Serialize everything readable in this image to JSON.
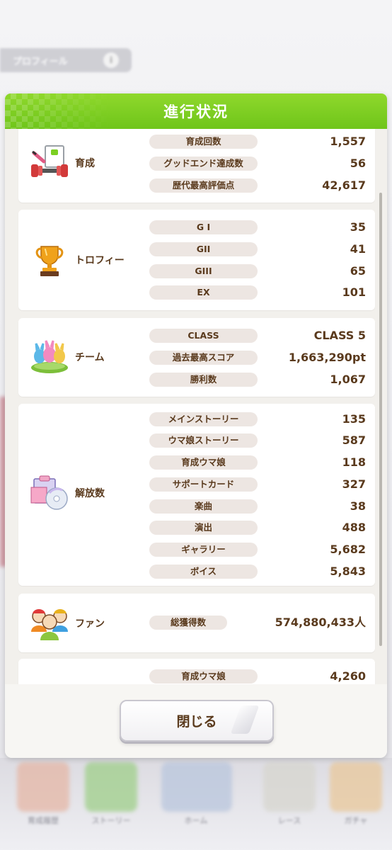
{
  "background": {
    "tab_label": "プロフィール",
    "tab_badge": "i",
    "bottom_labels": [
      "育成履歴",
      "ストーリー",
      "ホーム",
      "レース",
      "ガチャ"
    ]
  },
  "dialog": {
    "title": "進行状況",
    "close_label": "閉じる"
  },
  "sections": [
    {
      "name": "育成",
      "icon": "training-dumbbell-icon",
      "rows": [
        {
          "label": "育成回数",
          "value": "1,557"
        },
        {
          "label": "グッドエンド達成数",
          "value": "56"
        },
        {
          "label": "歴代最高評価点",
          "value": "42,617"
        }
      ]
    },
    {
      "name": "トロフィー",
      "icon": "trophy-icon",
      "rows": [
        {
          "label": "G I",
          "value": "35"
        },
        {
          "label": "GII",
          "value": "41"
        },
        {
          "label": "GIII",
          "value": "65"
        },
        {
          "label": "EX",
          "value": "101"
        }
      ]
    },
    {
      "name": "チーム",
      "icon": "team-icon",
      "rows": [
        {
          "label": "CLASS",
          "value": "CLASS 5"
        },
        {
          "label": "過去最高スコア",
          "value": "1,663,290pt"
        },
        {
          "label": "勝利数",
          "value": "1,067"
        }
      ]
    },
    {
      "name": "解放数",
      "icon": "unlock-media-icon",
      "rows": [
        {
          "label": "メインストーリー",
          "value": "135"
        },
        {
          "label": "ウマ娘ストーリー",
          "value": "587"
        },
        {
          "label": "育成ウマ娘",
          "value": "118"
        },
        {
          "label": "サポートカード",
          "value": "327"
        },
        {
          "label": "楽曲",
          "value": "38"
        },
        {
          "label": "演出",
          "value": "488"
        },
        {
          "label": "ギャラリー",
          "value": "5,682"
        },
        {
          "label": "ボイス",
          "value": "5,843"
        }
      ]
    },
    {
      "name": "ファン",
      "icon": "fans-icon",
      "rows": [
        {
          "label": "総獲得数",
          "value": "574,880,433人"
        }
      ]
    },
    {
      "name": "",
      "icon": "",
      "rows": [
        {
          "label": "育成ウマ娘",
          "value": "4,260"
        }
      ]
    }
  ],
  "colors": {
    "header_green": "#7ccf22",
    "text_brown": "#5a3a1d",
    "pill_bg": "#ede6e2"
  }
}
